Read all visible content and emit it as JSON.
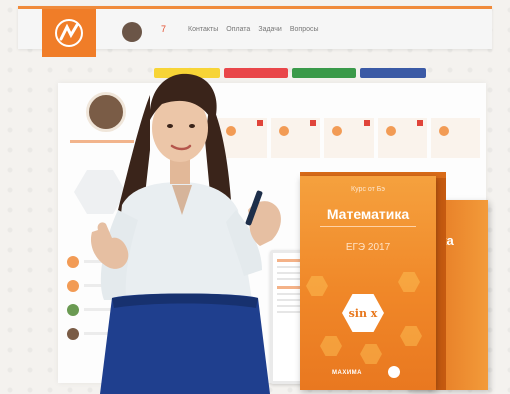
{
  "header": {
    "nav_items": [
      "Контакты",
      "Оплата",
      "Задачи",
      "Вопросы"
    ],
    "badge": "7"
  },
  "pills": [
    {
      "color": "#f7d436"
    },
    {
      "color": "#e9464a"
    },
    {
      "color": "#3a9a4a"
    },
    {
      "color": "#3b5aa6"
    }
  ],
  "product": {
    "subtitle": "Курс от Бэ",
    "title": "Математика",
    "year": "ЕГЭ 2017",
    "formula": "sin x",
    "brand": "МАХИМА",
    "back_title": "ка"
  },
  "colors": {
    "accent": "#f07d28",
    "box": "#f08728"
  }
}
